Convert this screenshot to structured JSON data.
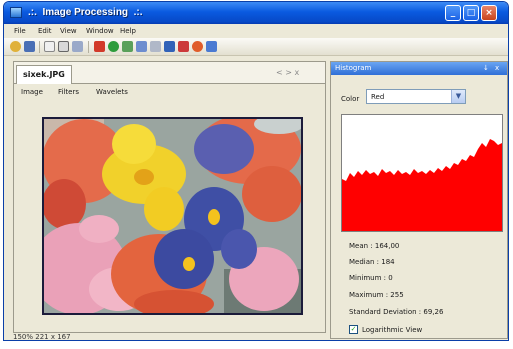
{
  "window": {
    "title": ".:.  Image Processing  .:."
  },
  "menubar": {
    "items": [
      "File",
      "Edit",
      "View",
      "Window",
      "Help"
    ]
  },
  "toolbar": {
    "icons": [
      "open-icon",
      "save-icon",
      "copy-icon",
      "print-icon",
      "cut-icon",
      "refresh-icon",
      "chart-icon",
      "undo-icon",
      "redo-icon",
      "effect-icon",
      "histogram-icon"
    ]
  },
  "document": {
    "tab_label": "sixek.JPG",
    "tab_nav": "< >  x",
    "menu": [
      "Image",
      "Filters",
      "Wavelets"
    ]
  },
  "statusbar": {
    "text": "150%  221 x 167"
  },
  "histogram_panel": {
    "title": "Histogram",
    "pin_symbol": "↓",
    "close_symbol": "x",
    "color_label": "Color",
    "color_value": "Red",
    "color": "#ff0000",
    "stats": [
      "Mean : 164,00",
      "Median : 184",
      "Minimum : 0",
      "Maximum : 255",
      "Standard Deviation : 69,26"
    ],
    "logarithmic_label": "Logarithmic View",
    "logarithmic_checked": true
  }
}
